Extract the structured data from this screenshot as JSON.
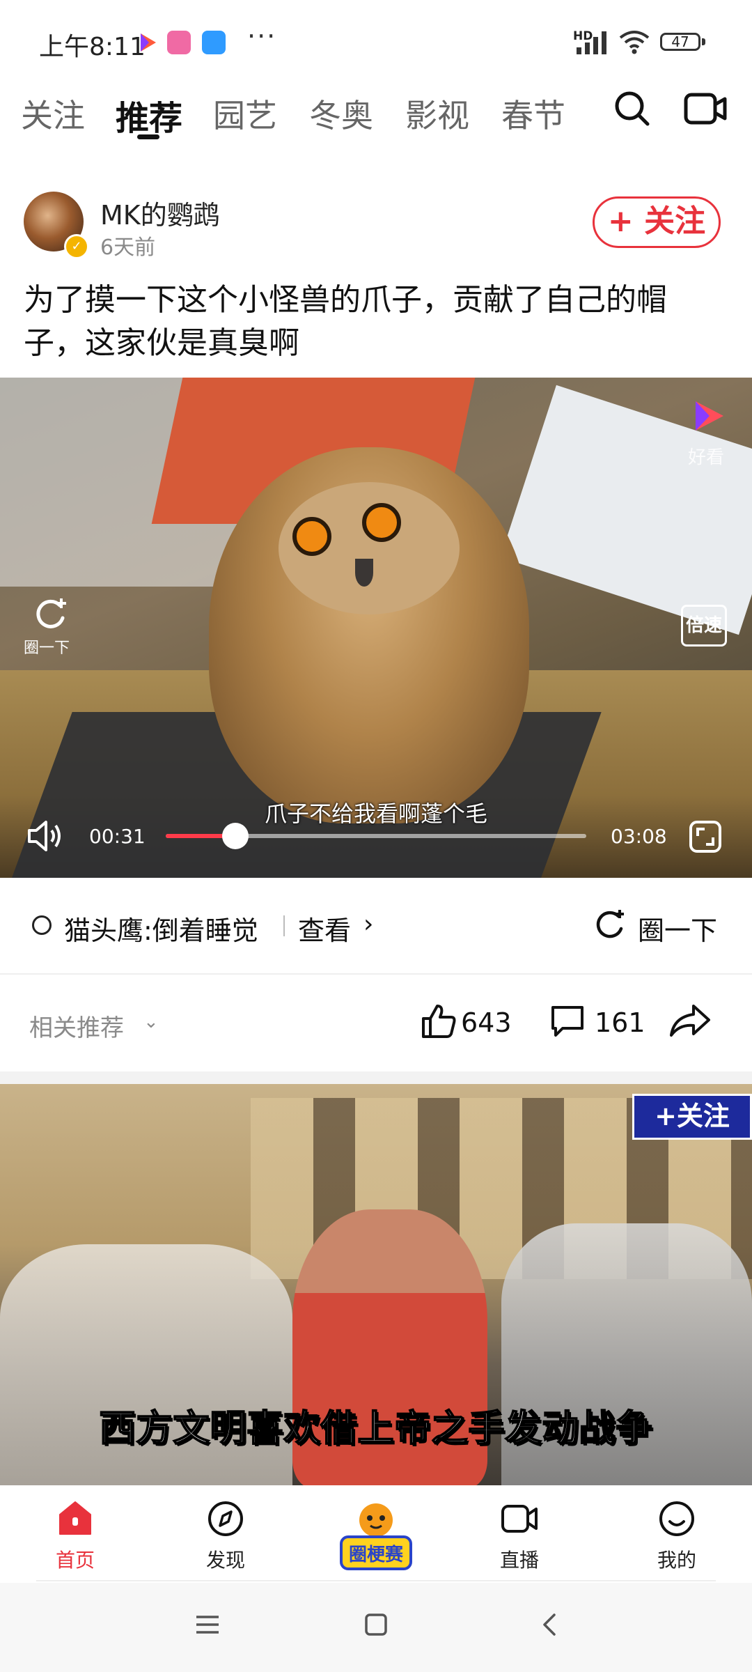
{
  "status_bar": {
    "time": "上午8:11",
    "more": "···",
    "network": "HD",
    "battery": "47"
  },
  "tabs": [
    {
      "label": "关注"
    },
    {
      "label": "推荐",
      "active": true
    },
    {
      "label": "园艺"
    },
    {
      "label": "冬奥"
    },
    {
      "label": "影视"
    },
    {
      "label": "春节"
    }
  ],
  "header_icons": [
    "search-icon",
    "camera-icon"
  ],
  "post": {
    "author": "MK的鹦鹉",
    "time_ago": "6天前",
    "follow_label": "+ 关注",
    "title": "为了摸一下这个小怪兽的爪子，贡献了自己的帽子，这家伙是真臭啊"
  },
  "video": {
    "logo_text": "好看",
    "quan_label": "圈一下",
    "speed_label": "倍速",
    "subtitle": "爪子不给我看啊蓬个毛",
    "current_time": "00:31",
    "duration": "03:08",
    "progress": 0.165
  },
  "topic": {
    "text": "猫头鹰:倒着睡觉",
    "view_label": "查看",
    "quan_label": "圈一下"
  },
  "actions": {
    "related_label": "相关推荐",
    "likes": "643",
    "comments": "161"
  },
  "next_video": {
    "follow_label": "+关注",
    "caption": "西方文明喜欢借上帝之手发动战争"
  },
  "bottom_nav": [
    {
      "label": "首页",
      "icon": "home-icon",
      "active": true
    },
    {
      "label": "发现",
      "icon": "compass-icon"
    },
    {
      "label": "圈梗赛",
      "icon": "tiger-badge"
    },
    {
      "label": "直播",
      "icon": "live-camera-icon"
    },
    {
      "label": "我的",
      "icon": "smiley-icon"
    }
  ],
  "colors": {
    "accent": "#e8323c",
    "text": "#111111",
    "muted": "#8a8a8a"
  }
}
